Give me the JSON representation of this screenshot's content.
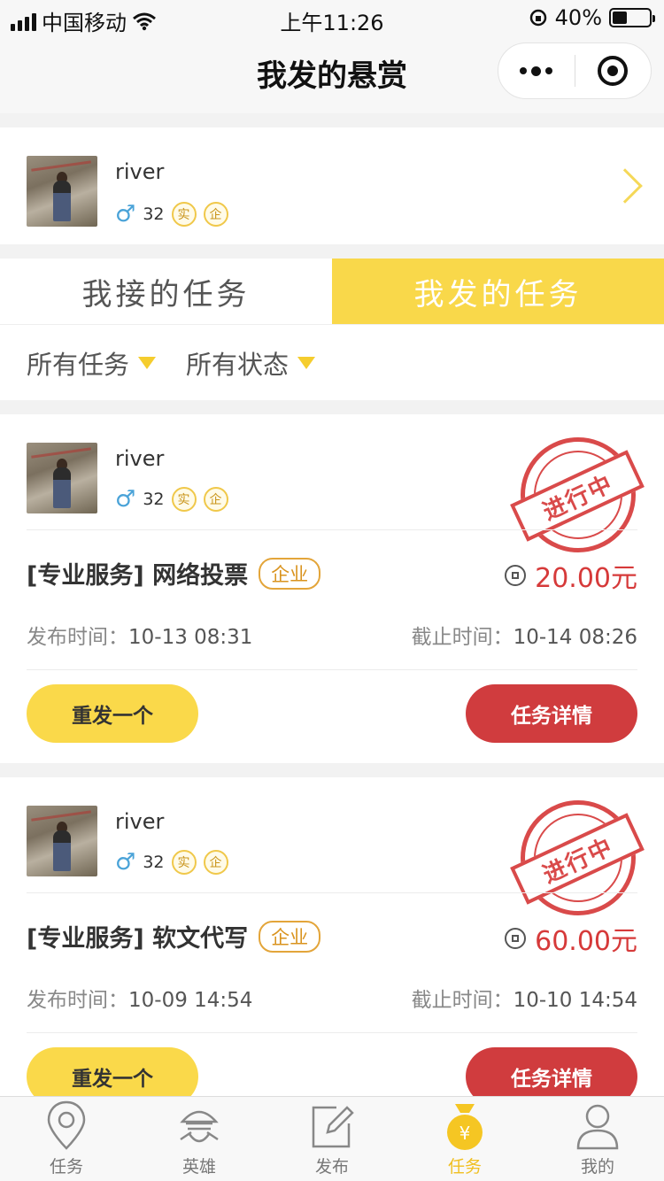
{
  "status_bar": {
    "carrier": "中国移动",
    "time": "上午11:26",
    "battery": "40%",
    "battery_level": 0.4
  },
  "nav": {
    "title": "我发的悬赏"
  },
  "profile": {
    "name": "river",
    "age": "32",
    "badge_real": "实",
    "badge_company": "企"
  },
  "tabs": [
    {
      "label": "我接的任务",
      "active": false
    },
    {
      "label": "我发的任务",
      "active": true
    }
  ],
  "filters": [
    {
      "label": "所有任务"
    },
    {
      "label": "所有状态"
    }
  ],
  "tasks": [
    {
      "user": {
        "name": "river",
        "age": "32",
        "badge_real": "实",
        "badge_company": "企"
      },
      "status": "进行中",
      "title": "[专业服务] 网络投票",
      "tag": "企业",
      "price": "20.00元",
      "publish_label": "发布时间：",
      "publish_time": "10-13 08:31",
      "deadline_label": "截止时间：",
      "deadline_time": "10-14 08:26",
      "repost_label": "重发一个",
      "detail_label": "任务详情"
    },
    {
      "user": {
        "name": "river",
        "age": "32",
        "badge_real": "实",
        "badge_company": "企"
      },
      "status": "进行中",
      "title": "[专业服务] 软文代写",
      "tag": "企业",
      "price": "60.00元",
      "publish_label": "发布时间：",
      "publish_time": "10-09 14:54",
      "deadline_label": "截止时间：",
      "deadline_time": "10-10 14:54",
      "repost_label": "重发一个",
      "detail_label": "任务详情"
    }
  ],
  "tab_bar": [
    {
      "label": "任务",
      "icon": "location-pin-icon",
      "active": false
    },
    {
      "label": "英雄",
      "icon": "hero-icon",
      "active": false
    },
    {
      "label": "发布",
      "icon": "edit-icon",
      "active": false
    },
    {
      "label": "任务",
      "icon": "money-bag-icon",
      "active": true
    },
    {
      "label": "我的",
      "icon": "user-icon",
      "active": false
    }
  ],
  "colors": {
    "accent_yellow": "#f9d84a",
    "accent_red": "#d03c3e",
    "price_red": "#d63a3a"
  }
}
